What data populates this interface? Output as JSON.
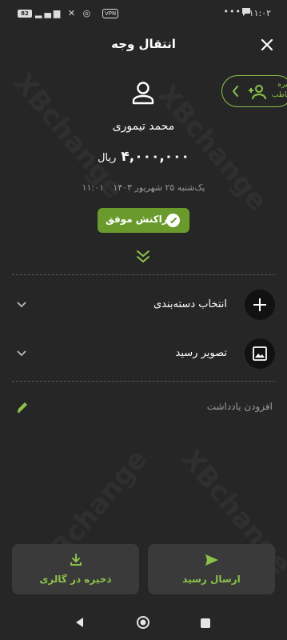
{
  "status_bar": {
    "battery": "82",
    "signal_icons": "▂▄▆ ✕ ◎",
    "vpn": "VPN",
    "dots": "•••",
    "chat_icon": "chat-bubble-icon",
    "time": "۱۱:۰۲"
  },
  "header": {
    "title": "انتقال وجه",
    "close_icon": "close-icon"
  },
  "save_contact": {
    "label_line1": "ذخیره",
    "label_line2": "مخاطب"
  },
  "recipient": {
    "name": "محمد تیموری",
    "amount": "۴,۰۰۰,۰۰۰",
    "currency": "ریال",
    "date": "یک‌شنبه ۲۵ شهریور ۱۴۰۳",
    "time": "۱۱:۰۱"
  },
  "status_badge": {
    "label": "تراکنش موفق",
    "color": "#6a9a2b"
  },
  "options": {
    "category": "انتخاب دسته‌بندی",
    "receipt_image": "تصویر رسید",
    "add_note": "افزودن یادداشت"
  },
  "actions": {
    "save_gallery": "ذخیره در گالری",
    "send_receipt": "ارسال رسید"
  },
  "watermark": "XBchange",
  "colors": {
    "accent": "#8bc34a",
    "background": "#262626",
    "card": "#3a3a3a"
  }
}
